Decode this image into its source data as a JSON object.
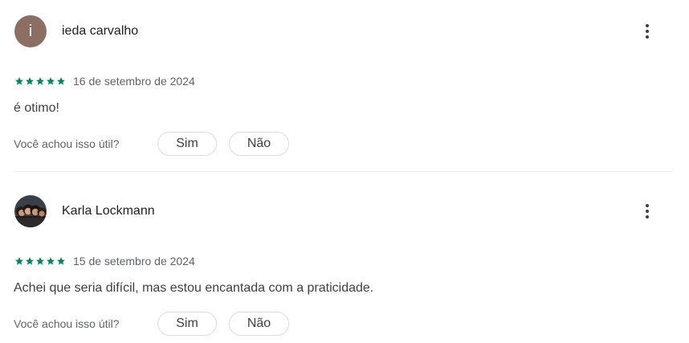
{
  "reviews": [
    {
      "author": "ieda carvalho",
      "avatar_letter": "i",
      "avatar_color": "#8d6e63",
      "rating": 5,
      "date": "16 de setembro de 2024",
      "text": "é otimo!",
      "helpful_question": "Você achou isso útil?",
      "yes_label": "Sim",
      "no_label": "Não",
      "more_icon": "more-vert-icon"
    },
    {
      "author": "Karla Lockmann",
      "avatar_image": "group-photo",
      "rating": 5,
      "date": "15 de setembro de 2024",
      "text": "Achei que seria difícil, mas estou encantada com a praticidade.",
      "helpful_question": "Você achou isso útil?",
      "yes_label": "Sim",
      "no_label": "Não",
      "more_icon": "more-vert-icon"
    }
  ],
  "colors": {
    "star": "#01875f",
    "text": "#3c4043",
    "secondary": "#5f6368",
    "border": "#dadce0"
  }
}
